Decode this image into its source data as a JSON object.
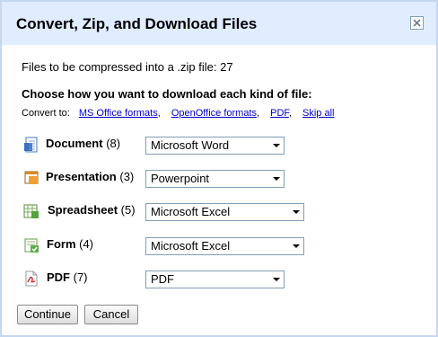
{
  "dialog": {
    "title": "Convert, Zip, and Download Files",
    "count_text": "Files to be compressed into a .zip file: 27",
    "choose_heading": "Choose how you want to download each kind of file:",
    "convert_to_label": "Convert to:",
    "convert_links": [
      "MS Office formats",
      "OpenOffice formats",
      "PDF",
      "Skip all"
    ]
  },
  "file_types": [
    {
      "name": "Document",
      "count": "(8)",
      "icon": "document-icon",
      "format": "Microsoft Word"
    },
    {
      "name": "Presentation",
      "count": "(3)",
      "icon": "presentation-icon",
      "format": "Powerpoint"
    },
    {
      "name": "Spreadsheet",
      "count": "(5)",
      "icon": "spreadsheet-icon",
      "format": "Microsoft Excel"
    },
    {
      "name": "Form",
      "count": "(4)",
      "icon": "form-icon",
      "format": "Microsoft Excel"
    },
    {
      "name": "PDF",
      "count": "(7)",
      "icon": "pdf-icon",
      "format": "PDF"
    }
  ],
  "buttons": {
    "continue": "Continue",
    "cancel": "Cancel"
  },
  "colors": {
    "titlebar_bg": "#e0ecff",
    "link": "#0000cc",
    "border": "#c5d7ef"
  }
}
